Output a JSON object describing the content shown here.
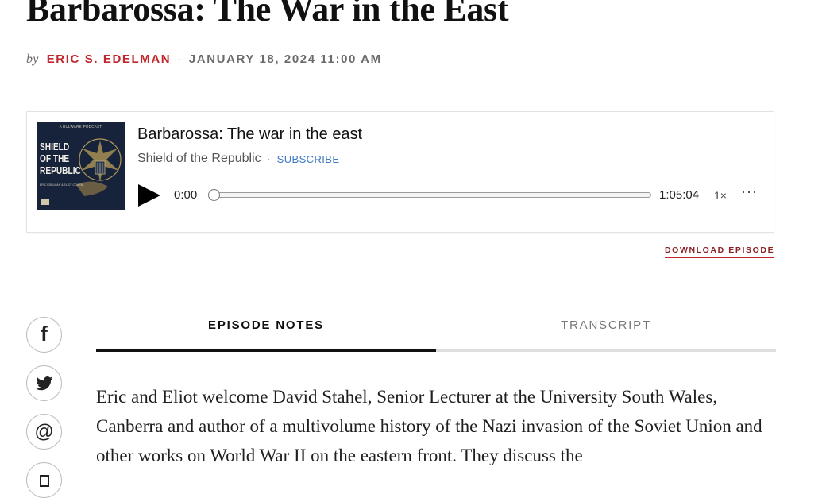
{
  "article": {
    "title": "Barbarossa: The War in the East",
    "by_label": "by",
    "author": "ERIC S. EDELMAN",
    "separator": "·",
    "date": "JANUARY 18, 2024 11:00 AM"
  },
  "player": {
    "cover": {
      "top_line": "A BULWARK PODCAST",
      "show_name_lines": [
        "SHIELD",
        "OF THE",
        "REPUBLIC"
      ],
      "hosts": "ERIC EDELMAN & ELIOT COHEN"
    },
    "episode_title": "Barbarossa: The war in the east",
    "show_name": "Shield of the Republic",
    "meta_separator": "·",
    "subscribe_label": "SUBSCRIBE",
    "current_time": "0:00",
    "duration": "1:05:04",
    "progress": 0,
    "speed": "1×",
    "more_label": "···"
  },
  "download_label": "DOWNLOAD EPISODE",
  "share": {
    "icons": [
      "facebook-icon",
      "twitter-icon",
      "email-icon",
      "link-icon"
    ],
    "facebook_glyph": "f",
    "email_glyph": "@"
  },
  "tabs": [
    {
      "label": "EPISODE NOTES",
      "active": true
    },
    {
      "label": "TRANSCRIPT",
      "active": false
    }
  ],
  "notes": {
    "text": "Eric and Eliot welcome David Stahel, Senior Lecturer at the University South Wales, Canberra and author of a multivolume history of the Nazi invasion of the Soviet Union and other works on World War II on the eastern front. They discuss the"
  },
  "colors": {
    "accent_red": "#c0282e",
    "download_red": "#8a1f24",
    "link_blue": "#3f78c4",
    "cover_navy": "#17233a"
  }
}
